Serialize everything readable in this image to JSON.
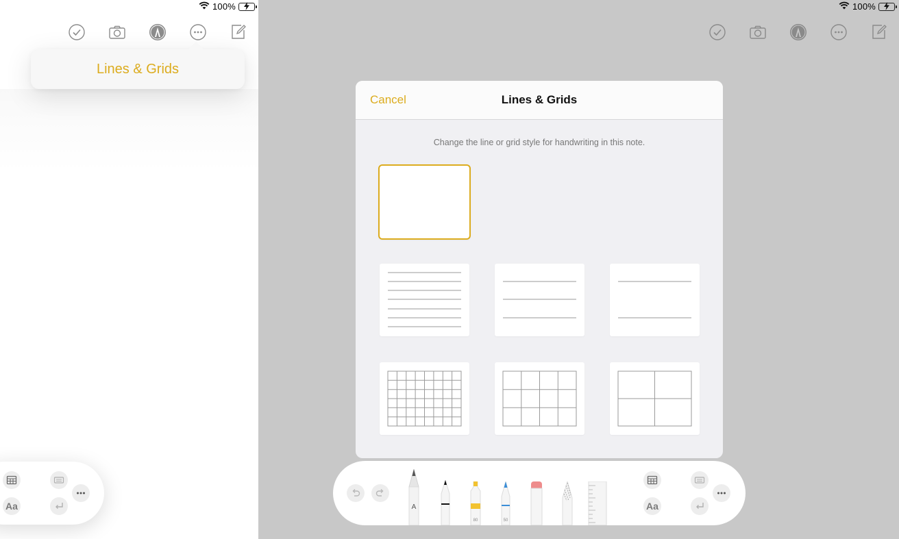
{
  "status": {
    "battery_percent": "100%",
    "icons": [
      "wifi-icon",
      "battery-icon"
    ],
    "battery_color": "#34c759"
  },
  "toolbar": {
    "icons": [
      "checklist-icon",
      "camera-icon",
      "markup-icon",
      "more-icon",
      "compose-icon"
    ]
  },
  "popover": {
    "label": "Lines & Grids"
  },
  "sheet": {
    "cancel_label": "Cancel",
    "title": "Lines & Grids",
    "description": "Change the line or grid style for handwriting in this note.",
    "styles": [
      "blank",
      "lines-narrow",
      "lines-medium",
      "lines-wide",
      "grid-small",
      "grid-medium",
      "grid-large"
    ],
    "selected": "blank"
  },
  "palette": {
    "left_icons": [
      "table-icon",
      "text-format-icon",
      "keyboard-icon",
      "return-icon",
      "more-icon"
    ],
    "text_format_label": "Aa",
    "tools": [
      "pencil",
      "pen",
      "marker",
      "colored-pencil",
      "eraser",
      "lasso",
      "ruler"
    ],
    "tool_labels": {
      "pencil": "A",
      "marker": "80",
      "colored-pencil": "50"
    },
    "undo_icon": "undo-icon",
    "redo_icon": "redo-icon"
  },
  "colors": {
    "accent": "#dcac1e",
    "dim_background": "#c8c8c8",
    "sheet_background": "#f0f0f3"
  }
}
